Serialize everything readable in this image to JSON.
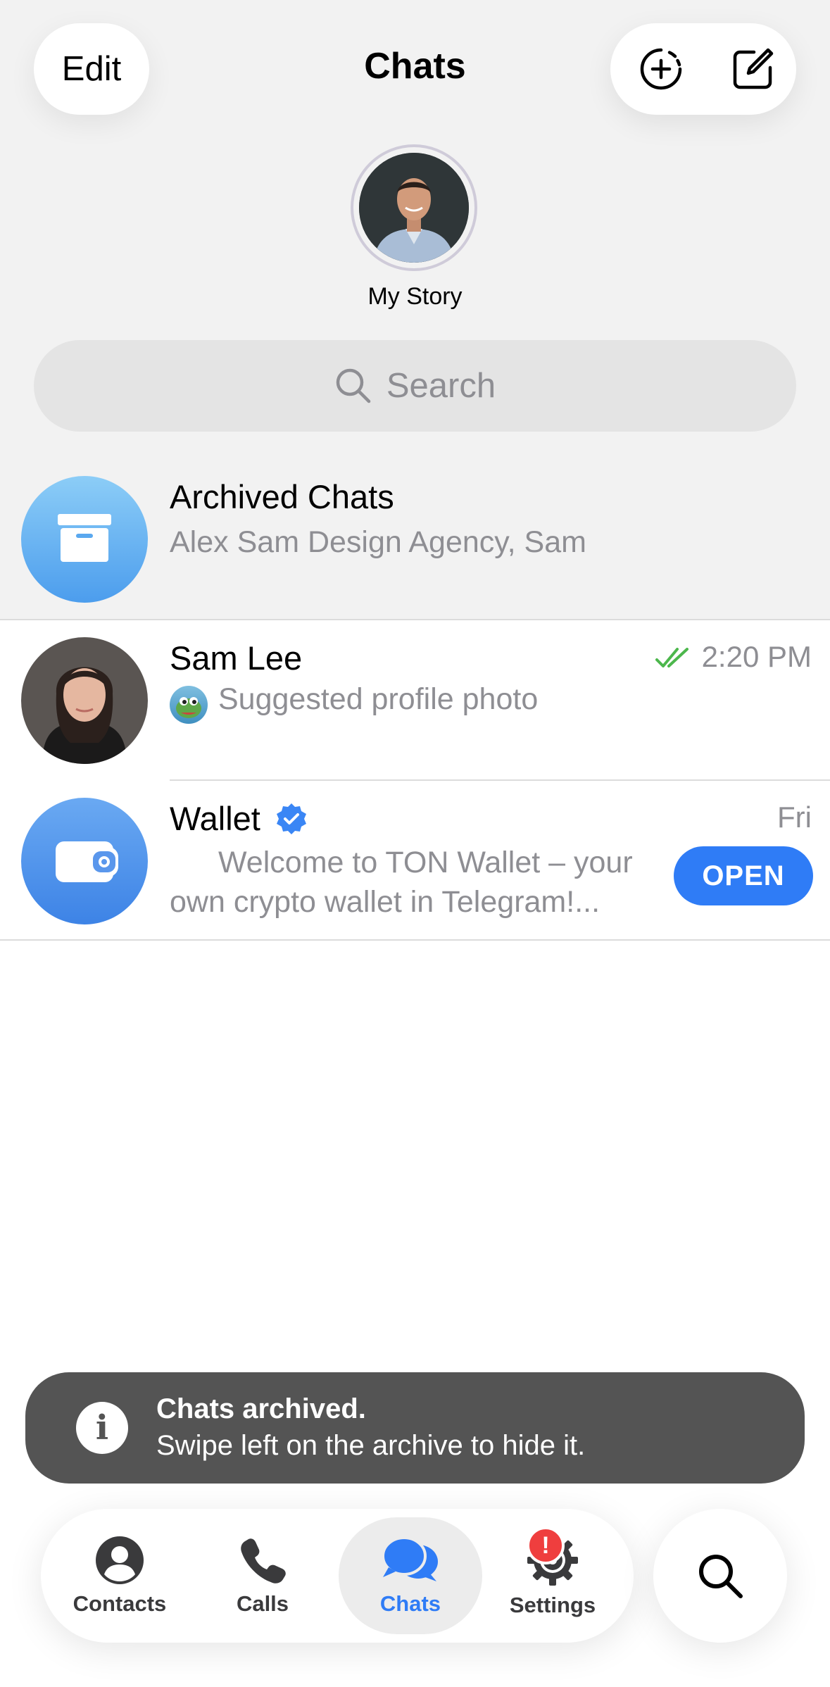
{
  "header": {
    "edit_label": "Edit",
    "title": "Chats",
    "add_story_icon": "circle-plus-dashed-icon",
    "compose_icon": "compose-icon"
  },
  "story": {
    "label": "My Story"
  },
  "search": {
    "placeholder": "Search"
  },
  "archived": {
    "title": "Archived Chats",
    "subtitle": "Alex Sam Design Agency, Sam",
    "icon": "archive-box-icon"
  },
  "chats": [
    {
      "name": "Sam Lee",
      "time": "2:20 PM",
      "status_icon": "double-check-icon",
      "preview": "Suggested profile photo"
    },
    {
      "name": "Wallet",
      "verified": true,
      "time": "Fri",
      "preview_line1": "Welcome to TON Wallet – your",
      "preview_line2": "own crypto wallet in Telegram!...",
      "action_label": "OPEN"
    }
  ],
  "toast": {
    "title": "Chats archived.",
    "body": "Swipe left on the archive to hide it."
  },
  "tabbar": {
    "tabs": [
      {
        "label": "Contacts",
        "icon": "person-icon"
      },
      {
        "label": "Calls",
        "icon": "phone-icon"
      },
      {
        "label": "Chats",
        "icon": "chat-bubbles-icon",
        "active": true
      },
      {
        "label": "Settings",
        "icon": "gear-icon",
        "badge": "!"
      }
    ],
    "search_icon": "search-icon"
  },
  "colors": {
    "accent": "#2f7cf6",
    "archive_gradient_top": "#8ccdf7",
    "archive_gradient_bottom": "#4c9ded",
    "read_check": "#4cb74c",
    "badge": "#ef3e3e",
    "toast_bg": "#545454"
  }
}
